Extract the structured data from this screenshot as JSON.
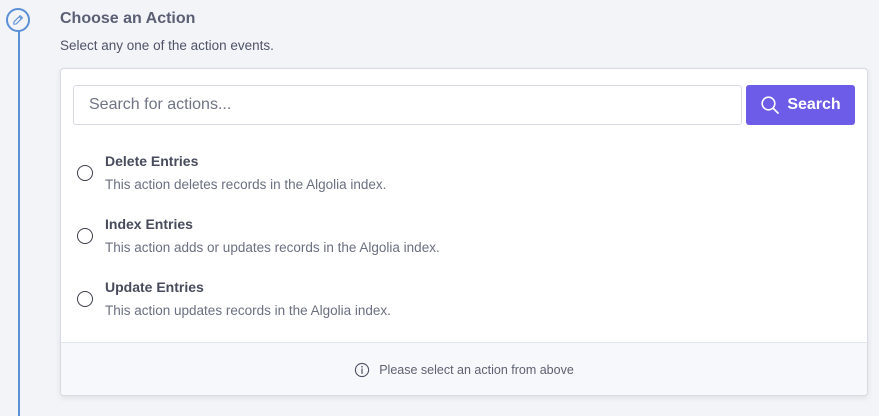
{
  "section": {
    "title": "Choose an Action",
    "subtitle": "Select any one of the action events."
  },
  "search": {
    "placeholder": "Search for actions...",
    "value": "",
    "button_label": "Search",
    "button_color": "#6c5ce7"
  },
  "actions": [
    {
      "title": "Delete Entries",
      "description": "This action deletes records in the Algolia index.",
      "selected": false
    },
    {
      "title": "Index Entries",
      "description": "This action adds or updates records in the Algolia index.",
      "selected": false
    },
    {
      "title": "Update Entries",
      "description": "This action updates records in the Algolia index.",
      "selected": false
    }
  ],
  "footer": {
    "message": "Please select an action from above",
    "icon": "info-icon"
  },
  "step": {
    "icon": "pencil-icon",
    "accent_color": "#5b8fd6"
  }
}
